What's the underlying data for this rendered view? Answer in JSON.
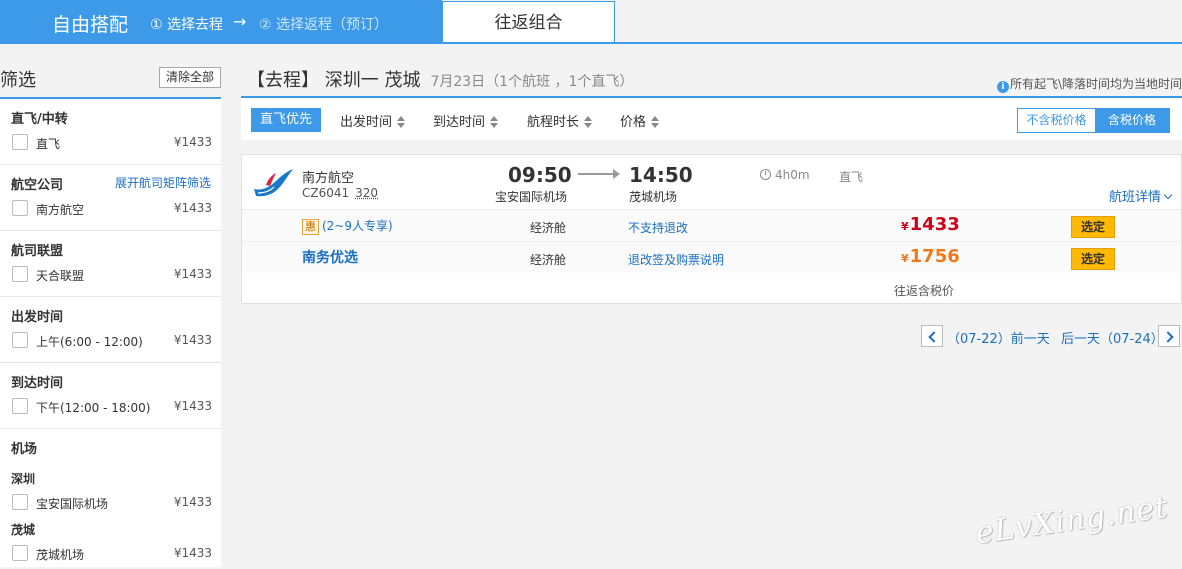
{
  "header": {
    "brand": "自由搭配",
    "step1": "① 选择去程",
    "arrow": "→",
    "step2": "② 选择返程（预订）",
    "tab_round": "往返组合"
  },
  "sidebar": {
    "title": "筛选",
    "clear_label": "清除全部",
    "sections": {
      "direct": {
        "title": "直飞/中转",
        "opt": "直飞",
        "price": "¥1433"
      },
      "airline": {
        "title": "航空公司",
        "link": "展开航司矩阵筛选",
        "opt": "南方航空",
        "price": "¥1433"
      },
      "alliance": {
        "title": "航司联盟",
        "opt": "天合联盟",
        "price": "¥1433"
      },
      "dep": {
        "title": "出发时间",
        "opt": "上午(6:00 - 12:00)",
        "price": "¥1433"
      },
      "arr": {
        "title": "到达时间",
        "opt": "下午(12:00 - 18:00)",
        "price": "¥1433"
      },
      "airport": {
        "title": "机场",
        "sub1": "深圳",
        "opt1": "宝安国际机场",
        "price1": "¥1433",
        "sub2": "茂城",
        "opt2": "茂城机场",
        "price2": "¥1433"
      }
    }
  },
  "main": {
    "route": "【去程】 深圳一 茂城",
    "date_info": "7月23日（1个航班 ，1个直飞）",
    "tz_note": "所有起飞\\降落时间均为当地时间",
    "sort": {
      "active": "直飞优先",
      "items": [
        "出发时间",
        "到达时间",
        "航程时长",
        "价格"
      ]
    },
    "tax": {
      "exclude": "不含税价格",
      "include": "含税价格"
    }
  },
  "flight": {
    "airline": "南方航空",
    "flight_no": "CZ6041",
    "plane": "320",
    "dep_time": "09:50",
    "dep_airport": "宝安国际机场",
    "arr_time": "14:50",
    "arr_airport": "茂城机场",
    "duration": "4h0m",
    "direct": "直飞",
    "details": "航班详情",
    "fares": [
      {
        "badge": "惠",
        "tag": "(2~9人专享)",
        "cabin": "经济舱",
        "rule": "不支持退改",
        "yen": "¥",
        "price": "1433",
        "btn": "选定"
      },
      {
        "tag": "南务优选",
        "cabin": "经济舱",
        "rule": "退改签及购票说明",
        "yen": "¥",
        "price": "1756",
        "btn": "选定"
      }
    ],
    "rt_tax": "往返含税价"
  },
  "pager": {
    "prev": "（07-22）前一天",
    "next": "后一天（07-24）"
  },
  "watermark": "eLvXing.net",
  "colors": {
    "accent": "#3c9ae8",
    "price_red": "#d0021b",
    "price_orange": "#f07a1a",
    "select": "#ffb900"
  }
}
